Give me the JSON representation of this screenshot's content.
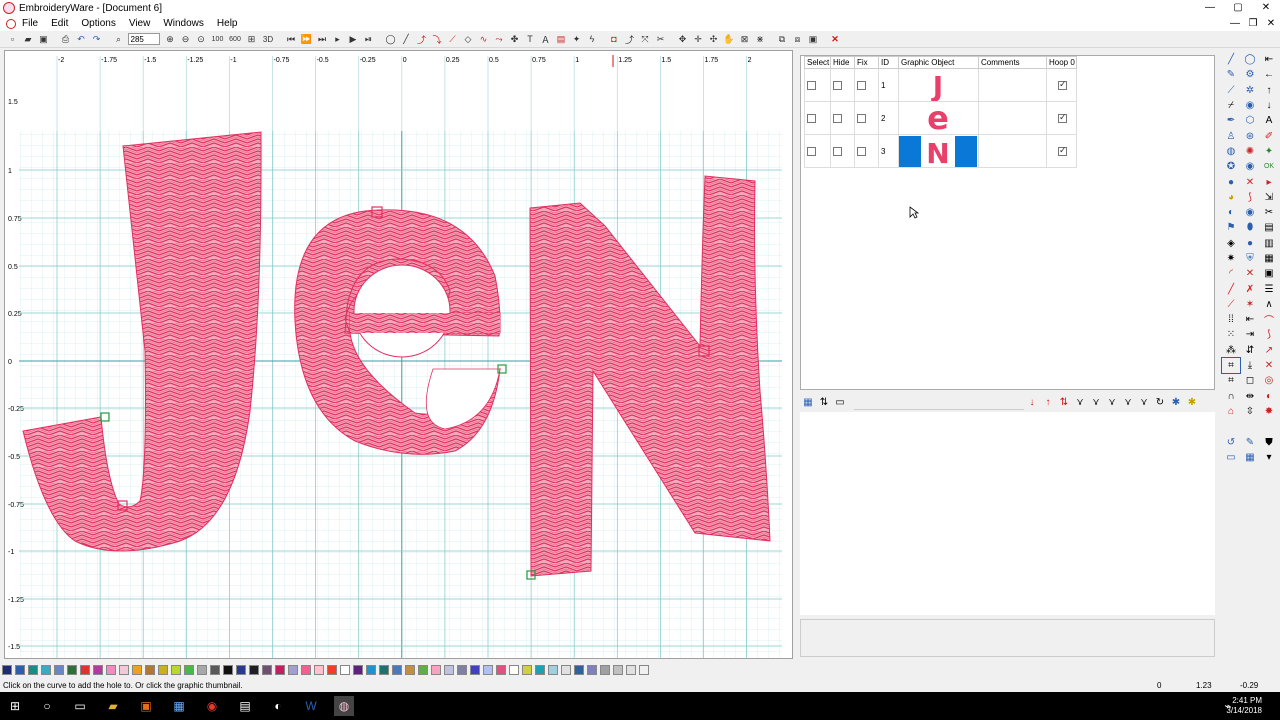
{
  "window": {
    "title": "EmbroideryWare - [Document 6]",
    "minimize": "—",
    "maximize": "▢",
    "close": "✕"
  },
  "menu": [
    "File",
    "Edit",
    "Options",
    "View",
    "Windows",
    "Help"
  ],
  "mdi_buttons": [
    "—",
    "❐",
    "✕"
  ],
  "toolbar": {
    "zoom_value": "285",
    "zoom_100": "100",
    "zoom_600": "600",
    "view_3d": "3D"
  },
  "ruler": {
    "top_labels": [
      "-2",
      "-1.75",
      "-1.5",
      "-1.25",
      "-1",
      "-0.75",
      "-0.5",
      "-0.25",
      "0",
      "0.25",
      "0.5",
      "0.75",
      "1",
      "1.25",
      "1.5",
      "1.75",
      "2"
    ],
    "left_labels": [
      "1.5",
      "1",
      "0.75",
      "0.5",
      "0.25",
      "0",
      "-0.25",
      "-0.5",
      "-0.75",
      "-1",
      "-1.25",
      "-1.5"
    ]
  },
  "design": {
    "letters": [
      "J",
      "e",
      "N"
    ],
    "fill_color": "#e8406a"
  },
  "object_list": {
    "headers": [
      "Select",
      "Hide",
      "Fix",
      "ID",
      "Graphic Object",
      "Comments",
      "Hoop 0"
    ],
    "rows": [
      {
        "id": "1",
        "glyph": "J",
        "selected": false,
        "hoop": true
      },
      {
        "id": "2",
        "glyph": "e",
        "selected": false,
        "hoop": true
      },
      {
        "id": "3",
        "glyph": "N",
        "selected": true,
        "hoop": true
      }
    ]
  },
  "status": {
    "message": "Click on the curve to add the hole to.  Or click the graphic thumbnail.",
    "value1": "0",
    "value2": "1.23",
    "value3": "-0.29"
  },
  "clock": {
    "time": "2:41 PM",
    "date": "3/14/2018"
  },
  "colors": [
    "#1e2a78",
    "#2a5fb0",
    "#1a8a8a",
    "#3ca8c8",
    "#6a86c8",
    "#2e6e3a",
    "#e03030",
    "#b03aa0",
    "#f28cc0",
    "#f4c8d8",
    "#f0a020",
    "#b07830",
    "#c8b020",
    "#b8d830",
    "#48b848",
    "#a8a8a8",
    "#585858",
    "#101010",
    "#283890",
    "#202020",
    "#705070",
    "#c02060",
    "#a0a0d0",
    "#f06090",
    "#ffc0d0",
    "#f04020",
    "#ffffff",
    "#602080",
    "#2090d0",
    "#207070",
    "#4878c0",
    "#c09040",
    "#60b040",
    "#ffa0c0",
    "#c0c0e0",
    "#8080a0",
    "#4040c0",
    "#b0c0f0",
    "#e05080",
    "#ffffff",
    "#d0d040",
    "#20a0b0",
    "#a0d0e0",
    "#e0e0e0",
    "#3060a0",
    "#8080c0",
    "#a0a0a0",
    "#c0c0c0",
    "#e0e0e0",
    "#f0f0f0"
  ]
}
